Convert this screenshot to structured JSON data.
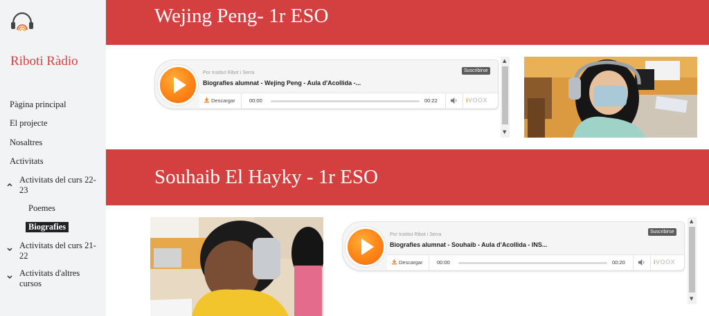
{
  "sidebar": {
    "site_title": "Riboti Ràdio",
    "nav": [
      {
        "label": "Pàgina principal"
      },
      {
        "label": "El projecte"
      },
      {
        "label": "Nosaltres"
      },
      {
        "label": "Activitats"
      },
      {
        "label": "Activitats del curs 22-23"
      },
      {
        "label": "Poemes"
      },
      {
        "label": "Biografies"
      },
      {
        "label": "Activitats del curs 21-22"
      },
      {
        "label": "Activitats d'altres cursos"
      }
    ]
  },
  "sections": [
    {
      "heading": "Wejing Peng- 1r ESO",
      "player": {
        "by": "Por Institut Ribot i Serra",
        "title": "Biografies alumnat - Wejing Peng - Aula d'Acollida -...",
        "subscribe": "Suscribirse",
        "download": "Descargar",
        "current_time": "00:00",
        "duration": "00:22",
        "brand": "ivoox"
      }
    },
    {
      "heading": "Souhaib El Hayky - 1r ESO",
      "player": {
        "by": "Por Institut Ribot i Serra",
        "title": "Biografies alumnat - Souhaib - Aula d'Acollida - INS...",
        "subscribe": "Suscribirse",
        "download": "Descargar",
        "current_time": "00:00",
        "duration": "00:20",
        "brand": "ivoox"
      }
    }
  ],
  "colors": {
    "banner": "#d43f3f",
    "site_title": "#d94141",
    "sidebar_bg": "#f1f3f4",
    "play_orange": "#ff8a1a"
  }
}
